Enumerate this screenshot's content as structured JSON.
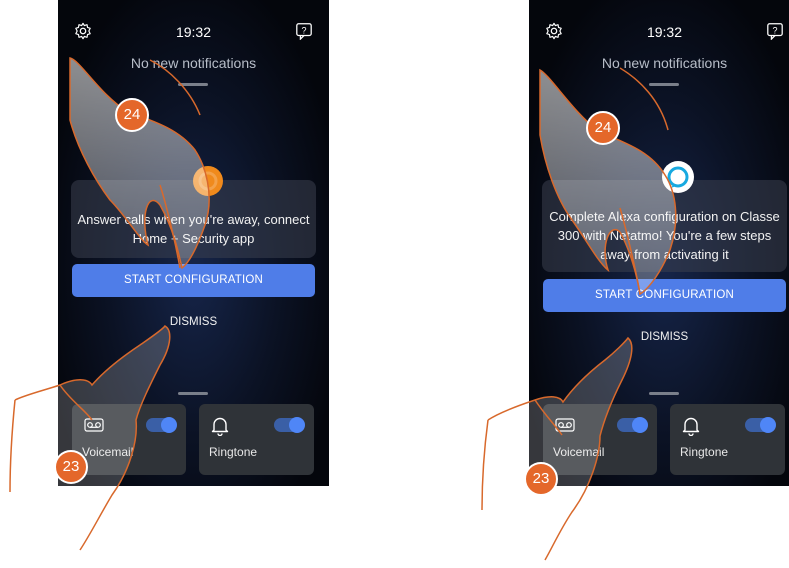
{
  "panels": [
    {
      "status_bar": {
        "time": "19:32",
        "settings_icon": "gear-icon",
        "help_icon": "help-icon"
      },
      "notifications": "No new notifications",
      "card": {
        "icon": "netatmo-app-icon",
        "text": "Answer calls when you're away, connect Home + Security app"
      },
      "cta_label": "START CONFIGURATION",
      "dismiss_label": "DISMISS",
      "tiles": [
        {
          "label": "Voicemail",
          "icon": "voicemail-icon",
          "toggle_on": true
        },
        {
          "label": "Ringtone",
          "icon": "bell-icon",
          "toggle_on": true
        }
      ],
      "callouts": [
        "24",
        "23"
      ]
    },
    {
      "status_bar": {
        "time": "19:32",
        "settings_icon": "gear-icon",
        "help_icon": "help-icon"
      },
      "notifications": "No new notifications",
      "card": {
        "icon": "alexa-icon",
        "text": "Complete Alexa configuration on Classe 300 with Netatmo! You're a few steps away from activating it"
      },
      "cta_label": "START CONFIGURATION",
      "dismiss_label": "DISMISS",
      "tiles": [
        {
          "label": "Voicemail",
          "icon": "voicemail-icon",
          "toggle_on": true
        },
        {
          "label": "Ringtone",
          "icon": "bell-icon",
          "toggle_on": true
        }
      ],
      "callouts": [
        "24",
        "23"
      ]
    }
  ],
  "colors": {
    "accent": "#4f7de8",
    "callout": "#e4672a",
    "hand_outline": "#d8692c"
  }
}
